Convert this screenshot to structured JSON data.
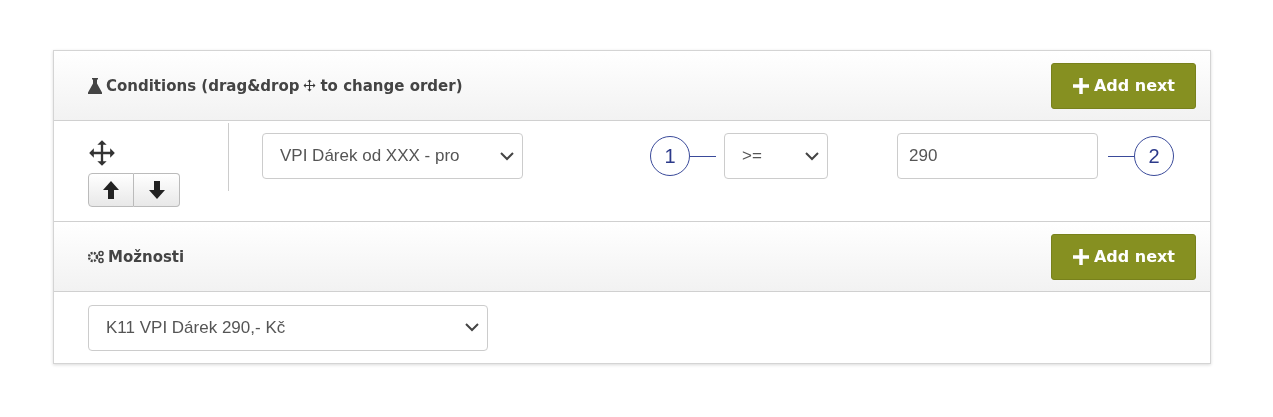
{
  "conditions": {
    "title_before": "Conditions (drag&drop",
    "title_after": "to change order)",
    "add_button": "Add next",
    "rows": [
      {
        "field": "VPI Dárek od XXX - pro",
        "operator": ">=",
        "value": "290",
        "callouts": [
          "1",
          "2"
        ]
      }
    ]
  },
  "options": {
    "title": "Možnosti",
    "add_button": "Add next",
    "select": "K11 VPI Dárek 290,- Kč"
  }
}
